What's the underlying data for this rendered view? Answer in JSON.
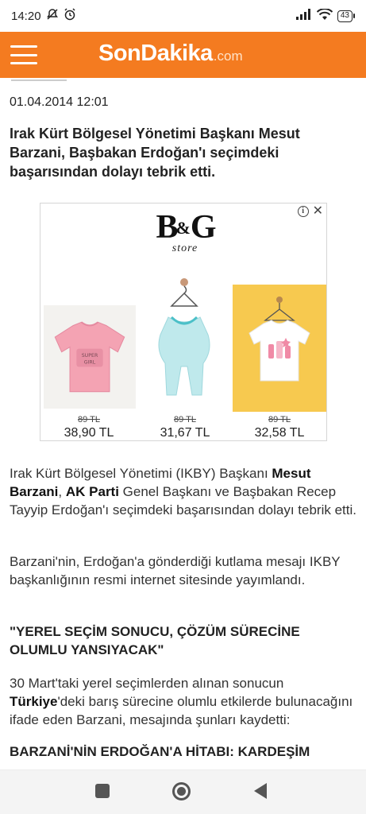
{
  "status_bar": {
    "time": "14:20",
    "battery": "43"
  },
  "header": {
    "logo_main": "SonDakika",
    "logo_sub": ".com"
  },
  "article": {
    "date": "01.04.2014 12:01",
    "summary": "Irak Kürt Bölgesel Yönetimi Başkanı Mesut Barzani, Başbakan Erdoğan'ı seçimdeki başarısından dolayı tebrik etti.",
    "p1_a": "Irak Kürt Bölgesel Yönetimi (IKBY) Başkanı ",
    "p1_link1": "Mesut Barzani",
    "p1_b": ", ",
    "p1_link2": "AK Parti",
    "p1_c": " Genel Başkanı ve Başbakan Recep Tayyip Erdoğan'ı seçimdeki başarısından dolayı tebrik etti.",
    "p2": "Barzani'nin, Erdoğan'a gönderdiği kutlama mesajı IKBY başkanlığının resmi internet sitesinde yayımlandı.",
    "quote": "\"YEREL SEÇİM SONUCU, ÇÖZÜM SÜRECİNE OLUMLU YANSIYACAK\"",
    "p3_a": "30 Mart'taki yerel seçimlerden alınan sonucun ",
    "p3_link": "Türkiye",
    "p3_b": "'deki barış sürecine olumlu etkilerde bulunacağını ifade eden Barzani, mesajında şunları kaydetti:",
    "subheading": "BARZANİ'NİN ERDOĞAN'A HİTABI: KARDEŞİM"
  },
  "ad": {
    "brand": "B&G",
    "brand_first": "B",
    "brand_amp": "&",
    "brand_last": "G",
    "brand_sub": "store",
    "products": [
      {
        "old_price": "89 TL",
        "new_price": "38,90 TL",
        "color": "#f4a3b3"
      },
      {
        "old_price": "89 TL",
        "new_price": "31,67 TL",
        "color": "#bfe9ec"
      },
      {
        "old_price": "89 TL",
        "new_price": "32,58 TL",
        "color": "#f7c94f"
      }
    ]
  },
  "colors": {
    "header": "#f47b20"
  }
}
